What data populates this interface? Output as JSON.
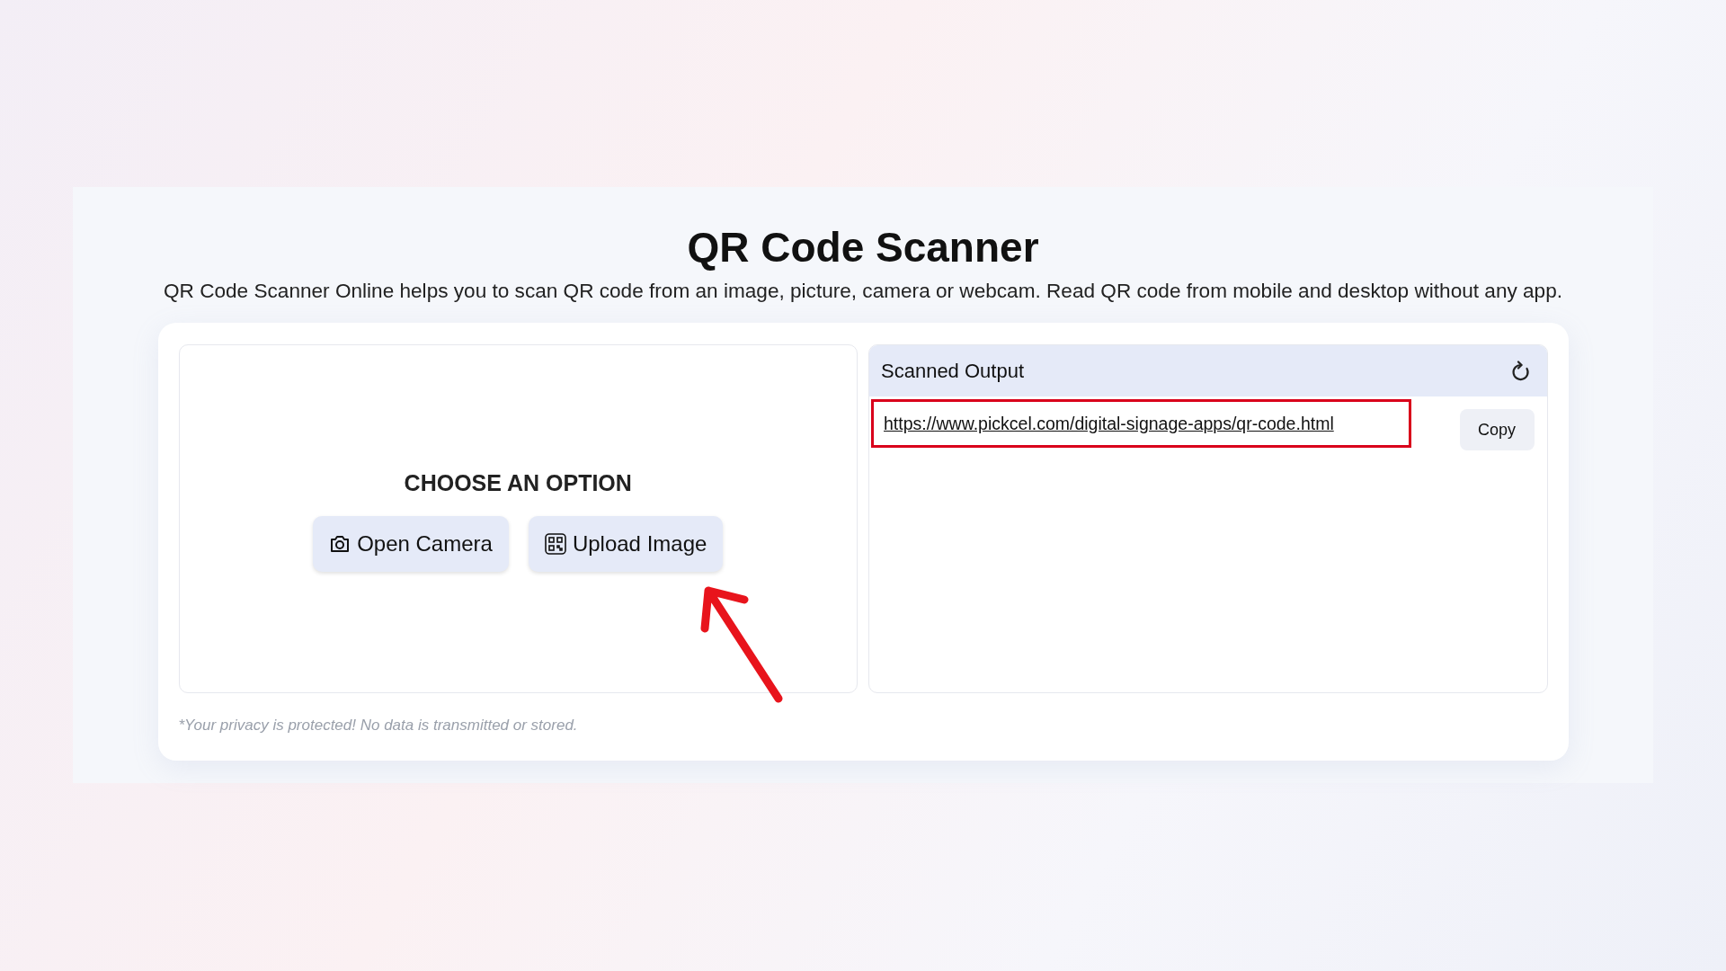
{
  "title": "QR Code Scanner",
  "subtitle": "QR Code Scanner Online helps you to scan QR code from an image, picture, camera or webcam. Read QR code from mobile and desktop without any app.",
  "chooser": {
    "heading": "CHOOSE AN OPTION",
    "buttons": [
      {
        "kind": "camera",
        "label": "Open Camera"
      },
      {
        "kind": "upload",
        "label": "Upload Image"
      }
    ]
  },
  "output": {
    "title": "Scanned Output",
    "url": "https://www.pickcel.com/digital-signage-apps/qr-code.html",
    "copy_label": "Copy"
  },
  "privacy_note": "*Your privacy is protected! No data is transmitted or stored."
}
